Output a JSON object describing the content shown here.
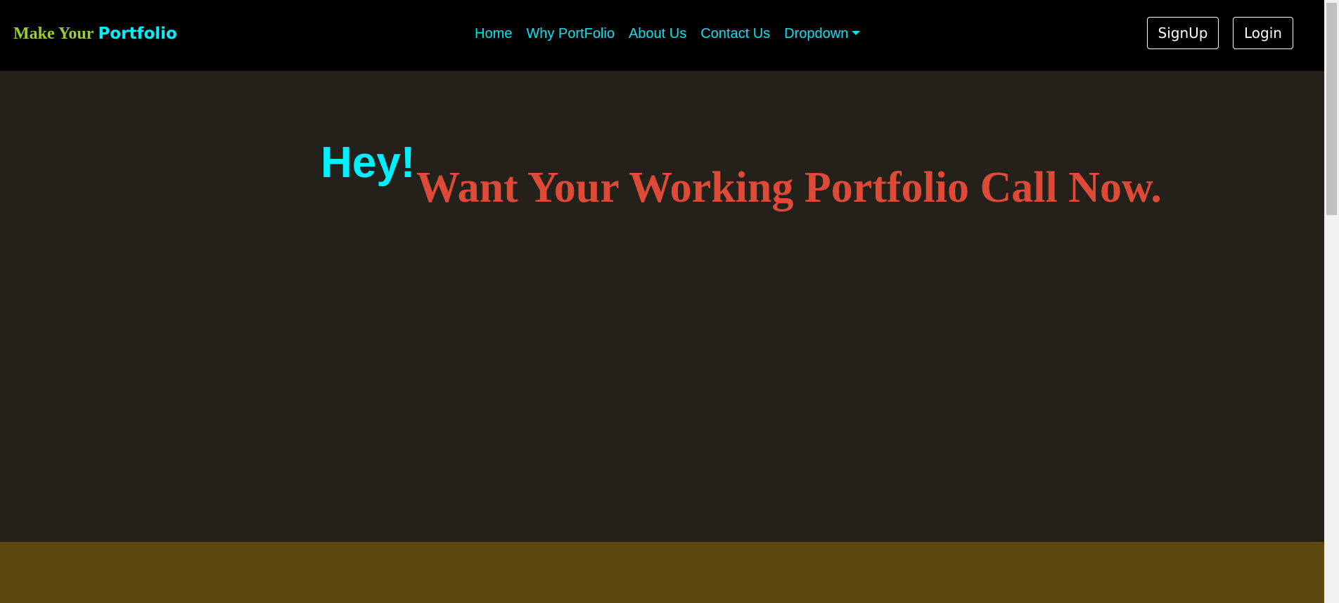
{
  "brand": {
    "part1": "Make Your",
    "part2": "Portfolio"
  },
  "nav": {
    "links": [
      "Home",
      "Why PortFolio",
      "About Us",
      "Contact Us",
      "Dropdown"
    ]
  },
  "buttons": {
    "signup": "SignUp",
    "login": "Login"
  },
  "hero": {
    "hey": "Hey!",
    "tagline": "Want Your Working Portfolio Call Now."
  },
  "colors": {
    "navbar_bg": "#000000",
    "hero_bg": "#23211a",
    "band_bg": "#5c490d",
    "link": "#0be0f0",
    "brand_green": "#9acd32",
    "accent_cyan": "#00f0ff",
    "tagline_red": "#dd4a38"
  }
}
